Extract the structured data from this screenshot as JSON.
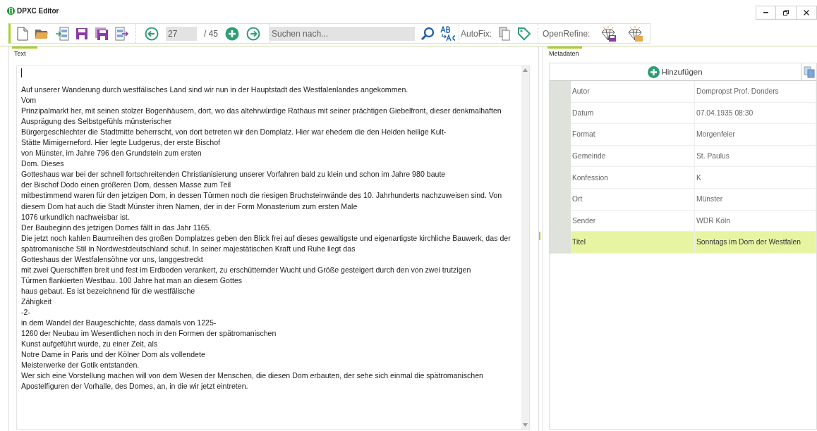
{
  "window": {
    "title": "DPXC Editor"
  },
  "toolbar": {
    "page_field": {
      "value": "27"
    },
    "page_total": "/ 45",
    "search": {
      "placeholder": "Suchen nach..."
    },
    "autofix_label": "AutoFix:",
    "openrefine_label": "OpenRefine:"
  },
  "text_pane": {
    "title": "Text",
    "lines": [
      "Auf unserer Wanderung durch westfälisches Land sind wir nun in der Hauptstadt des Westfalenlandes angekommen.",
      "Vom",
      "Prinzipalmarkt her, mit seinen stolzer Bogenhäusern, dort, wo das altehrwürdige Rathaus mit seiner prächtigen Giebelfront, dieser denkmalhaften",
      "Ausprägung des Selbstgefühls münsterischer",
      "Bürgergeschlechter die Stadtmitte beherrscht, von dort betreten wir den Domplatz. Hier war ehedem die den Heiden heilige Kult-",
      "Stätte Mimigerneford. Hier legte Ludgerus, der erste Bischof",
      "von Münster, im Jahre 796 den Grundstein zum ersten",
      "Dom. Dieses",
      "Gotteshaus war bei der schnell fortschreitenden Christianisierung unserer Vorfahren bald zu klein und schon im Jahre 980 baute",
      "der Bischof Dodo einen größeren Dom, dessen Masse zum Teil",
      "mitbestimmend waren für den jetzigen Dom, in dessen Türmen noch die riesigen Bruchsteinwände des 10. Jahrhunderts nachzuweisen sind. Von",
      "diesem Dom hat auch die Stadt Münster ihren Namen, der in der Form Monasterium zum ersten Male",
      "1076 urkundlich nachweisbar ist.",
      "Der Baubeginn des jetzigen Domes fällt in das Jahr 1165.",
      "Die jetzt noch kahlen Baumreihen des großen Domplatzes geben den Blick frei auf dieses gewaltigste und eigenartigste kirchliche Bauwerk, das der",
      "spätromanische Stil in Nordwestdeutschland schuf. In seiner majestätischen Kraft und Ruhe liegt das",
      "Gotteshaus der Westfalensöhne vor uns, langgestreckt",
      "mit zwei Querschiffen breit und fest im Erdboden verankert, zu erschütternder Wucht und Größe gesteigert durch den von zwei trutzigen",
      "Türmen flankierten Westbau. 100 Jahre hat man an diesem Gottes",
      "haus gebaut. Es ist bezeichnend für die westfälische",
      "Zähigkeit",
      "-2-",
      "in dem Wandel der Baugeschichte, dass damals von 1225-",
      "1260 der Neubau im Wesentlichen noch in den Formen der spätromanischen",
      "Kunst aufgeführt wurde, zu einer Zeit, als",
      "Notre Dame in Paris und der Kölner Dom als vollendete",
      "Meisterwerke der Gotik entstanden.",
      "Wer sich eine Vorstellung machen will von dem Wesen der Menschen, die diesen Dom erbauten, der sehe sich einmal die spätromanischen",
      "Apostelfiguren der Vorhalle, des Domes, an, in die wir jetzt eintreten."
    ]
  },
  "metadata_pane": {
    "title": "Metadaten",
    "add_button": "Hinzufügen",
    "rows": [
      {
        "key": "Autor",
        "value": "Dompropst Prof. Donders",
        "selected": false
      },
      {
        "key": "Datum",
        "value": "07.04.1935 08:30",
        "selected": false
      },
      {
        "key": "Format",
        "value": "Morgenfeier",
        "selected": false
      },
      {
        "key": "Gemeinde",
        "value": "St. Paulus",
        "selected": false
      },
      {
        "key": "Konfession",
        "value": "K",
        "selected": false
      },
      {
        "key": "Ort",
        "value": "Münster",
        "selected": false
      },
      {
        "key": "Sender",
        "value": "WDR Köln",
        "selected": false
      },
      {
        "key": "Titel",
        "value": "Sonntags im Dom der Westfalen",
        "selected": true
      }
    ]
  }
}
